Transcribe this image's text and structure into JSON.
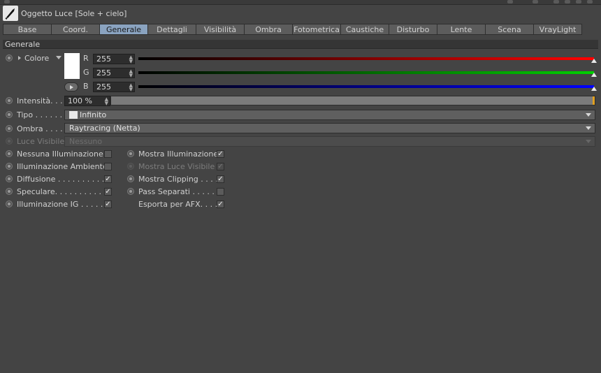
{
  "title": "Oggetto Luce [Sole + cielo]",
  "tabs": [
    "Base",
    "Coord.",
    "Generale",
    "Dettagli",
    "Visibilità",
    "Ombra",
    "Fotometrica",
    "Caustiche",
    "Disturbo",
    "Lente",
    "Scena",
    "VrayLight"
  ],
  "active_tab": "Generale",
  "section": "Generale",
  "colore": {
    "label": "Colore",
    "swatch_color": "#ffffff",
    "r_label": "R",
    "r_value": "255",
    "g_label": "G",
    "g_value": "255",
    "b_label": "B",
    "b_value": "255"
  },
  "intensita": {
    "label": "Intensità. . .",
    "value": "100 %",
    "fill_fraction": 1.0
  },
  "tipo": {
    "label": "Tipo . . . . . .",
    "value": "Infinito"
  },
  "ombra": {
    "label": "Ombra . . . .",
    "value": "Raytracing (Netta)"
  },
  "luce_visibile": {
    "label": "Luce Visibile",
    "value": "Nessuno"
  },
  "left_options": [
    {
      "label": "Nessuna Illuminazione",
      "checked": false
    },
    {
      "label": "Illuminazione Ambiente",
      "checked": false
    },
    {
      "label": "Diffusione . . . . . . . . . . .",
      "checked": true
    },
    {
      "label": "Speculare. . . . . . . . . . . .",
      "checked": true
    },
    {
      "label": "Illuminazione IG . . . . . .",
      "checked": true
    }
  ],
  "right_options": [
    {
      "label": "Mostra Illuminazione",
      "checked": true
    },
    {
      "label": "Mostra Luce Visibile",
      "checked": true
    },
    {
      "label": "Mostra Clipping . . . .",
      "checked": true
    },
    {
      "label": "Pass Separati . . . . . . .",
      "checked": false
    },
    {
      "label": "Esporta per AFX. . . . .",
      "checked": true
    }
  ],
  "checkmark": "✓"
}
